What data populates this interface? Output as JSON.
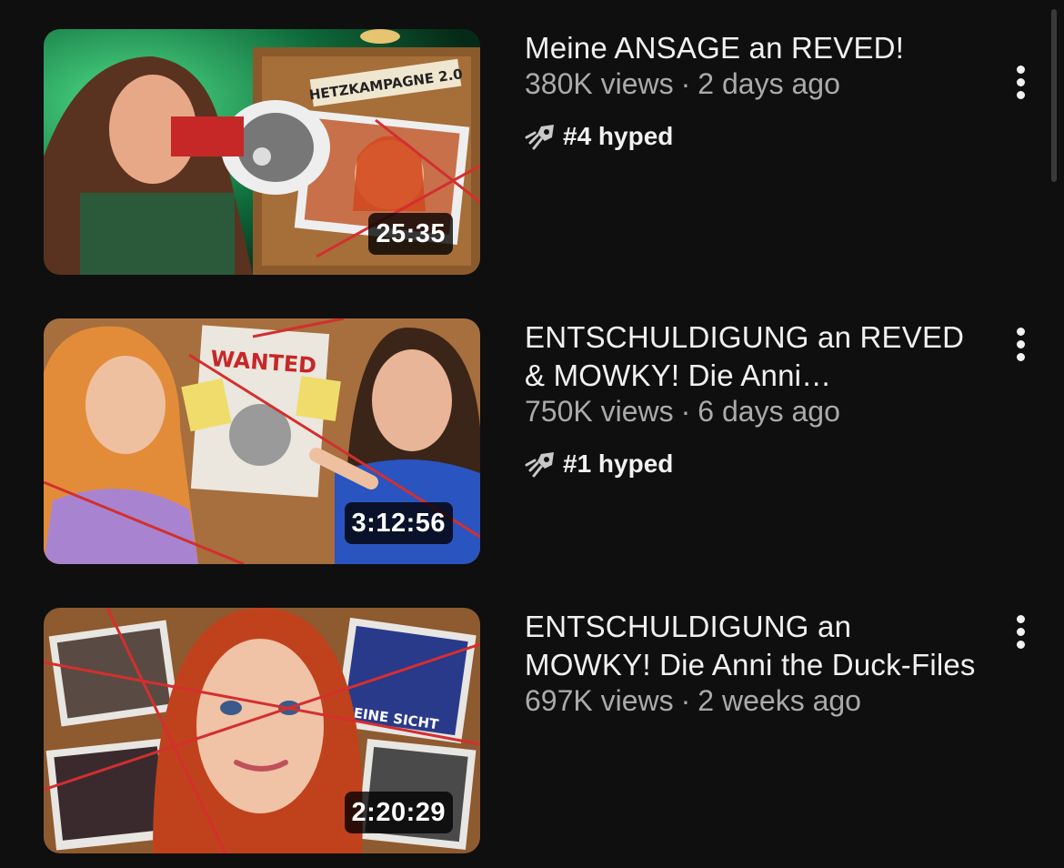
{
  "videos": [
    {
      "title": "Meine ANSAGE an REVED!",
      "views": "380K views",
      "age": "2 days ago",
      "hype": "#4 hyped",
      "duration": "25:35",
      "thumb_text": "HETZKAMPAGNE 2.0"
    },
    {
      "title": "ENTSCHULDIGUNG an REVED & MOWKY! Die Anni…",
      "views": "750K views",
      "age": "6 days ago",
      "hype": "#1 hyped",
      "duration": "3:12:56",
      "thumb_text": "WANTED"
    },
    {
      "title": "ENTSCHULDIGUNG an MOWKY! Die Anni the Duck-Files",
      "views": "697K views",
      "age": "2 weeks ago",
      "duration": "2:20:29",
      "thumb_text": "MEINE SICHT"
    }
  ],
  "separator": "·",
  "icons": {
    "hype": "rocket-hype-icon",
    "menu": "more-vert-icon"
  }
}
